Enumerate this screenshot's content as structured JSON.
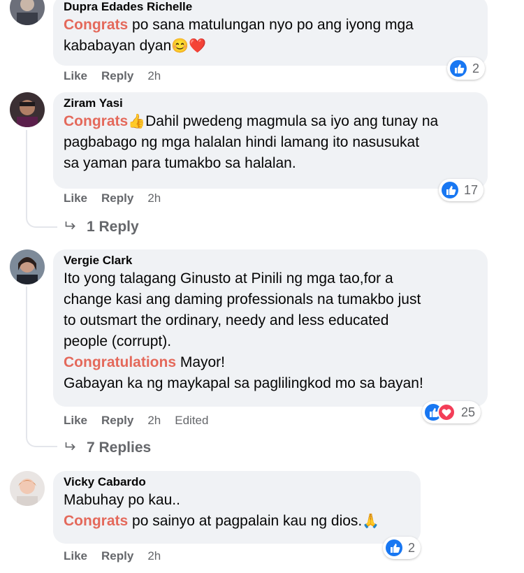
{
  "comments": [
    {
      "author": "Dupra Edades Richelle",
      "tag": "Congrats",
      "text_line1": " po sana matulungan nyo po ang iyong mga",
      "text_line2": "kababayan dyan",
      "emoji": "😊❤️",
      "like": "Like",
      "reply": "Reply",
      "time": "2h",
      "reaction_count": "2"
    },
    {
      "author": "Ziram Yasi",
      "tag": "Congrats",
      "emoji": "👍",
      "text_line1": "Dahil pwedeng magmula sa iyo ang tunay na",
      "text_line2": "pagbabago ng mga halalan hindi lamang ito nasusukat",
      "text_line3": "sa yaman para tumakbo sa halalan.",
      "like": "Like",
      "reply": "Reply",
      "time": "2h",
      "reaction_count": "17",
      "replies_link": "1 Reply"
    },
    {
      "author": "Vergie Clark",
      "text_line1": "Ito yong talagang Ginusto at Pinili ng mga tao,for a",
      "text_line2": "change kasi ang daming professionals na tumakbo just",
      "text_line3": "to outsmart the ordinary, needy and less educated",
      "text_line4": "people (corrupt).",
      "tag": "Congratulations",
      "text_line5": " Mayor!",
      "text_line6": "Gabayan ka ng maykapal sa paglilingkod mo sa bayan!",
      "like": "Like",
      "reply": "Reply",
      "time": "2h",
      "edited": "Edited",
      "reaction_count": "25",
      "replies_link": "7 Replies"
    },
    {
      "author": "Vicky Cabardo",
      "text_line1": "Mabuhay po kau..",
      "tag": "Congrats",
      "text_line2": " po sainyo at pagpalain kau ng dios.",
      "emoji": "🙏",
      "like": "Like",
      "reply": "Reply",
      "time": "2h",
      "reaction_count": "2"
    }
  ],
  "colors": {
    "tag": "#e4695b",
    "bubble": "#f0f2f5",
    "meta": "#65676b",
    "like_blue": "#1877f2",
    "love_red": "#f33e58"
  },
  "icons": {
    "like": "thumbs-up-reaction-icon",
    "love": "heart-reaction-icon",
    "reply_arrow": "reply-arrow-icon"
  }
}
